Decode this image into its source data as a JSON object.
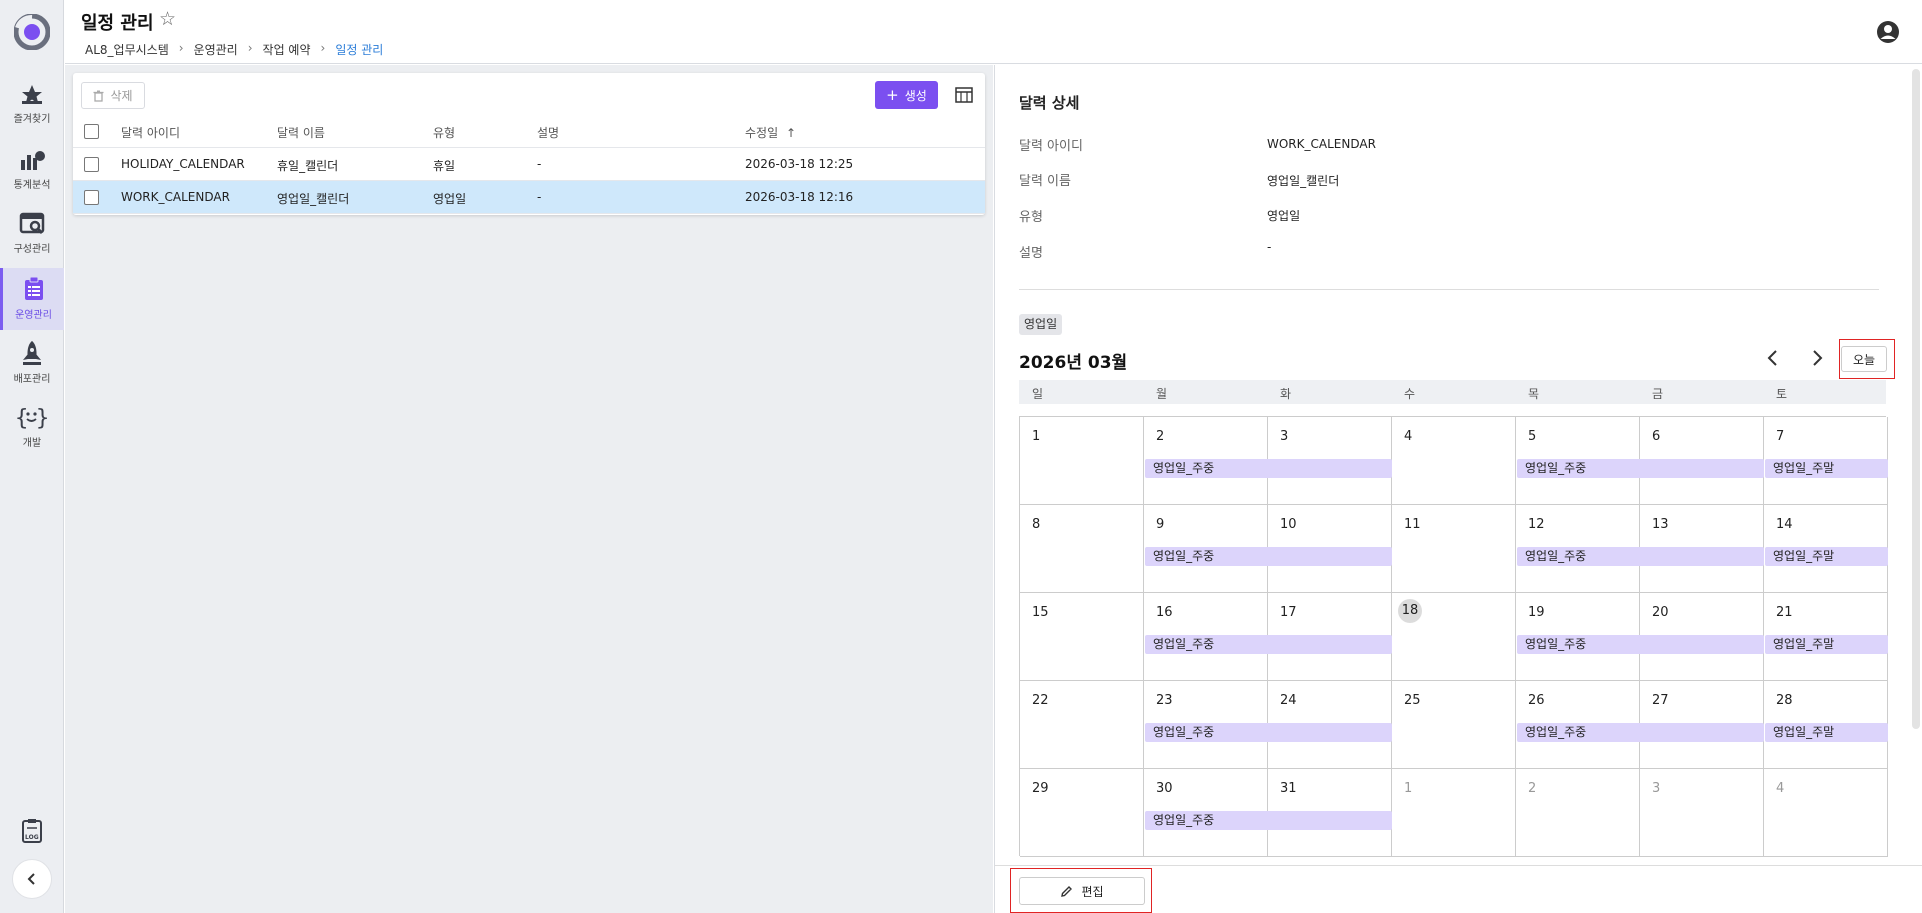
{
  "sidebar": {
    "items": [
      {
        "label": "즐겨찾기",
        "icon": "star-icon"
      },
      {
        "label": "통계분석",
        "icon": "analytics-icon"
      },
      {
        "label": "구성관리",
        "icon": "config-icon"
      },
      {
        "label": "운영관리",
        "icon": "clipboard-icon",
        "active": true
      },
      {
        "label": "배포관리",
        "icon": "rocket-icon"
      },
      {
        "label": "개발",
        "icon": "code-face-icon"
      }
    ]
  },
  "header": {
    "title": "일정 관리",
    "breadcrumb": [
      "AL8_업무시스템",
      "운영관리",
      "작업 예약",
      "일정 관리"
    ]
  },
  "list": {
    "delete_label": "삭제",
    "create_label": "생성",
    "columns": [
      "달력 아이디",
      "달력 이름",
      "유형",
      "설명",
      "수정일"
    ],
    "rows": [
      {
        "id": "HOLIDAY_CALENDAR",
        "name": "휴일_캘린더",
        "type": "휴일",
        "desc": "-",
        "modified": "2026-03-18 12:25"
      },
      {
        "id": "WORK_CALENDAR",
        "name": "영업일_캘린더",
        "type": "영업일",
        "desc": "-",
        "modified": "2026-03-18 12:16"
      }
    ]
  },
  "detail": {
    "title": "달력 상세",
    "fields": [
      {
        "label": "달력 아이디",
        "value": "WORK_CALENDAR"
      },
      {
        "label": "달력 이름",
        "value": "영업일_캘린더"
      },
      {
        "label": "유형",
        "value": "영업일"
      },
      {
        "label": "설명",
        "value": "-"
      }
    ],
    "tag": "영업일",
    "month_title": "2026년 03월",
    "today_label": "오늘",
    "weekdays": [
      "일",
      "월",
      "화",
      "수",
      "목",
      "금",
      "토"
    ],
    "weeks": [
      [
        "1",
        "2",
        "3",
        "4",
        "5",
        "6",
        "7"
      ],
      [
        "8",
        "9",
        "10",
        "11",
        "12",
        "13",
        "14"
      ],
      [
        "15",
        "16",
        "17",
        "18",
        "19",
        "20",
        "21"
      ],
      [
        "22",
        "23",
        "24",
        "25",
        "26",
        "27",
        "28"
      ],
      [
        "29",
        "30",
        "31",
        "1",
        "2",
        "3",
        "4"
      ]
    ],
    "other_month_from_week5_col": 3,
    "today_date": "18",
    "event_weekday": "영업일_주중",
    "event_weekend": "영업일_주말",
    "edit_label": "편집"
  },
  "colors": {
    "accent": "#7b4ff0",
    "selected_row": "#cfe8fb",
    "event_bg": "#dcd4fb",
    "highlight_border": "#e02424"
  }
}
